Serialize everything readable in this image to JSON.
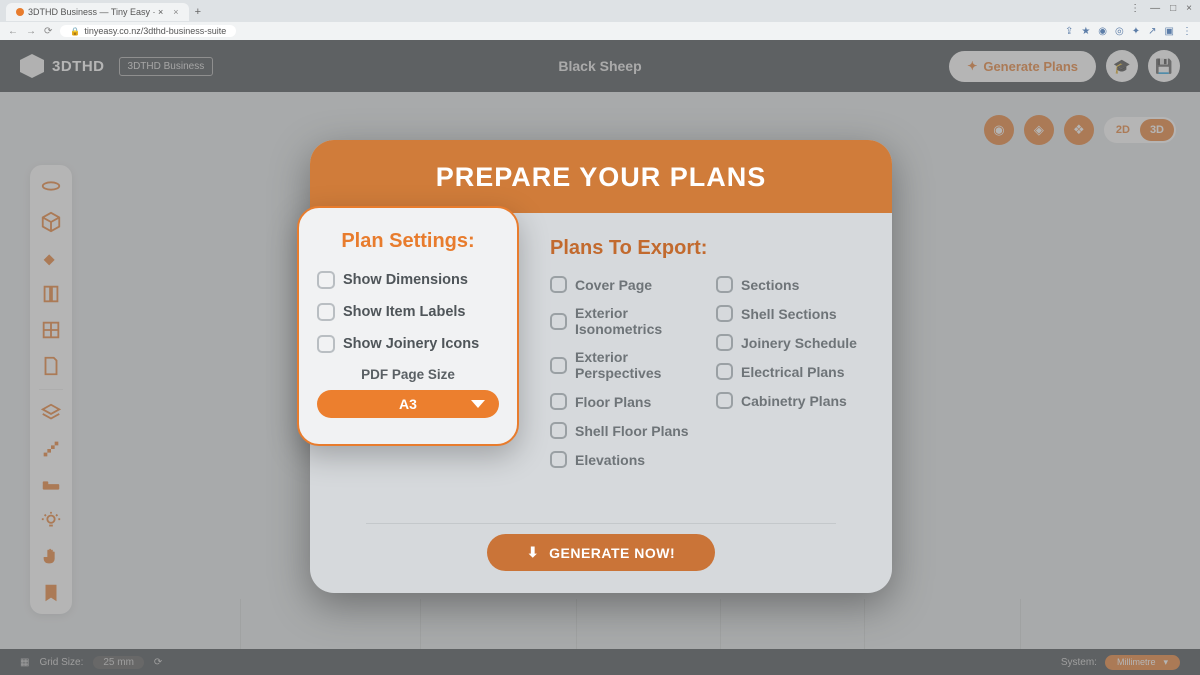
{
  "browser": {
    "tab_title": "3DTHD Business — Tiny Easy  ·  ×",
    "url": "tinyeasy.co.nz/3dthd-business-suite",
    "window_controls": {
      "min": "—",
      "max": "□",
      "close": "×"
    },
    "menu": "⋮"
  },
  "header": {
    "brand": "3DTHD",
    "tier": "3DTHD Business",
    "project": "Black Sheep",
    "generate": "Generate Plans"
  },
  "view_toggle": {
    "two_d": "2D",
    "three_d": "3D"
  },
  "modal": {
    "title": "PREPARE YOUR PLANS",
    "export_title": "Plans To Export:",
    "left_options": [
      "Cover Page",
      "Exterior Isonometrics",
      "Exterior Perspectives",
      "Floor Plans",
      "Shell Floor Plans",
      "Elevations"
    ],
    "right_options": [
      "Sections",
      "Shell Sections",
      "Joinery Schedule",
      "Electrical Plans",
      "Cabinetry Plans"
    ],
    "generate_now": "GENERATE NOW!"
  },
  "settings": {
    "title": "Plan Settings:",
    "options": [
      "Show Dimensions",
      "Show Item Labels",
      "Show Joinery Icons"
    ],
    "pdf_label": "PDF Page Size",
    "pdf_value": "A3"
  },
  "bottom": {
    "grid_label": "Grid Size:",
    "grid_value": "25 mm",
    "system_label": "System:",
    "system_value": "Millimetre"
  }
}
